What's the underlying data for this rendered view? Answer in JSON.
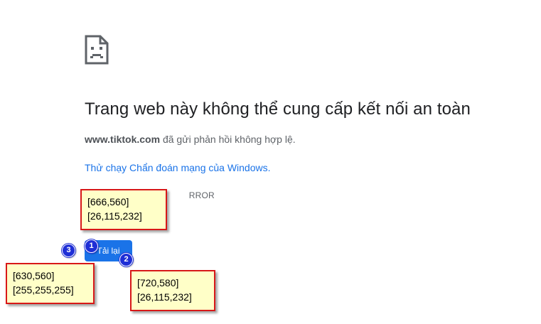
{
  "page": {
    "icon": "sad-page-icon",
    "title": "Trang web này không thể cung cấp kết nối an toàn",
    "host": "www.tiktok.com",
    "description_rest": " đã gửi phản hồi không hợp lệ.",
    "diagnostics_link": "Thử chạy Chẩn đoán mạng của Windows.",
    "error_code_visible": "RROR",
    "reload_label": "Tải lại"
  },
  "annotations": {
    "callout_1": {
      "line1": "[666,560]",
      "line2": "[26,115,232]"
    },
    "callout_2": {
      "line1": "[630,560]",
      "line2": "[255,255,255]"
    },
    "callout_3": {
      "line1": "[720,580]",
      "line2": "[26,115,232]"
    },
    "marker_1": "1",
    "marker_2": "2",
    "marker_3": "3"
  },
  "colors": {
    "button_bg": "#1a73e8",
    "link": "#1a73e8",
    "callout_bg": "#ffffc8",
    "callout_border": "#d81818",
    "marker": "#1f2fd6"
  }
}
